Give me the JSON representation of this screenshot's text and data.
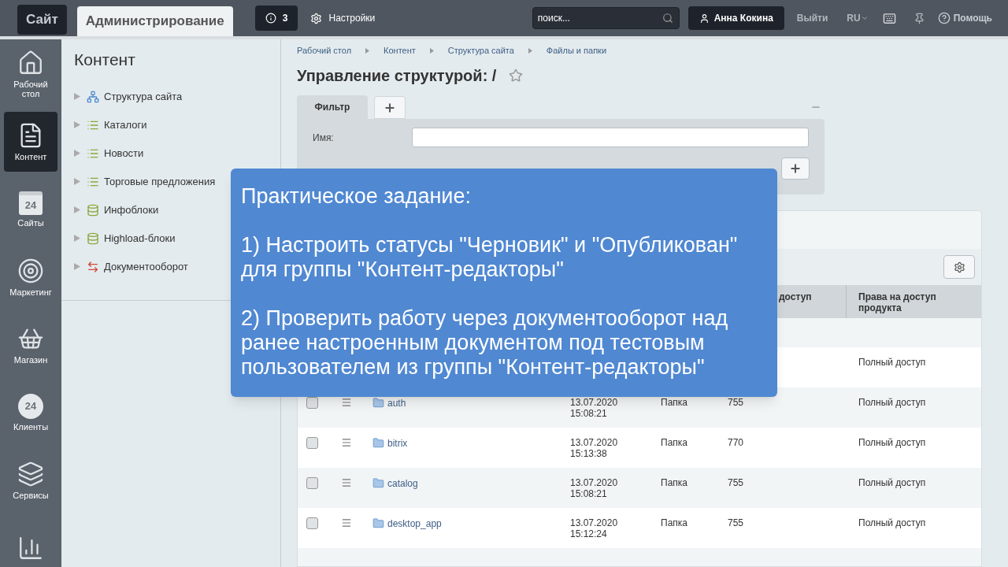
{
  "topbar": {
    "tabs": [
      {
        "label": "Сайт",
        "selected": false
      },
      {
        "label": "Администрирование",
        "selected": true
      }
    ],
    "notifications": {
      "count": "3"
    },
    "settings": "Настройки",
    "search": {
      "placeholder": "поиск..."
    },
    "user": "Анна Кокина",
    "logout": "Выйти",
    "language": "RU",
    "help": "Помощь"
  },
  "rail": [
    {
      "kind": "home",
      "label": "Рабочий стол",
      "selected": false
    },
    {
      "kind": "document",
      "label": "Контент",
      "selected": true
    },
    {
      "kind": "calendar",
      "label": "Сайты",
      "icon_text": "24",
      "selected": false
    },
    {
      "kind": "target",
      "label": "Маркетинг",
      "selected": false
    },
    {
      "kind": "basket",
      "label": "Магазин",
      "selected": false
    },
    {
      "kind": "cloud",
      "label": "Клиенты",
      "icon_text": "24",
      "selected": false
    },
    {
      "kind": "layers",
      "label": "Сервисы",
      "selected": false
    },
    {
      "kind": "chart",
      "selected": false
    }
  ],
  "sidebar": {
    "title": "Контент",
    "items": [
      {
        "kind": "structure",
        "label": "Структура сайта",
        "expanded": false
      },
      {
        "kind": "list",
        "label": "Каталоги",
        "expanded": false
      },
      {
        "kind": "list",
        "label": "Новости",
        "expanded": false
      },
      {
        "kind": "list",
        "label": "Торговые предложения",
        "expanded": false
      },
      {
        "kind": "iblock",
        "label": "Инфоблоки",
        "expanded": false
      },
      {
        "kind": "iblock",
        "label": "Highload-блоки",
        "expanded": false
      },
      {
        "kind": "workflow",
        "label": "Документооборот",
        "expanded": false
      }
    ]
  },
  "breadcrumbs": [
    "Рабочий стол",
    "Контент",
    "Структура сайта",
    "Файлы и папки"
  ],
  "page_title": "Управление структурой: /",
  "filter": {
    "tab": "Фильтр",
    "fields": [
      {
        "label": "Имя:"
      }
    ]
  },
  "table": {
    "columns": [
      "доступ",
      "Права на доступ продукта"
    ],
    "rows": [
      {
        "access": "Полный доступ"
      },
      {
        "checked": false,
        "name": "auth",
        "date": "13.07.2020",
        "time": "15:08:21",
        "type": "Папка",
        "perms": "755",
        "access": "Полный доступ"
      },
      {
        "checked": false,
        "name": "bitrix",
        "date": "13.07.2020",
        "time": "15:13:38",
        "type": "Папка",
        "perms": "770",
        "access": "Полный доступ"
      },
      {
        "checked": false,
        "name": "catalog",
        "date": "13.07.2020",
        "time": "15:08:21",
        "type": "Папка",
        "perms": "755",
        "access": "Полный доступ"
      },
      {
        "checked": false,
        "name": "desktop_app",
        "date": "13.07.2020",
        "time": "15:12:24",
        "type": "Папка",
        "perms": "755",
        "access": "Полный доступ"
      }
    ]
  },
  "overlay": {
    "title": "Практическое задание:",
    "paragraphs": [
      "1) Настроить статусы \"Черновик\" и \"Опубликован\" для группы \"Контент-редакторы\"",
      "2) Проверить работу через документооборот над ранее настроенным документом под тестовым пользователем из группы \"Контент-редакторы\""
    ]
  }
}
